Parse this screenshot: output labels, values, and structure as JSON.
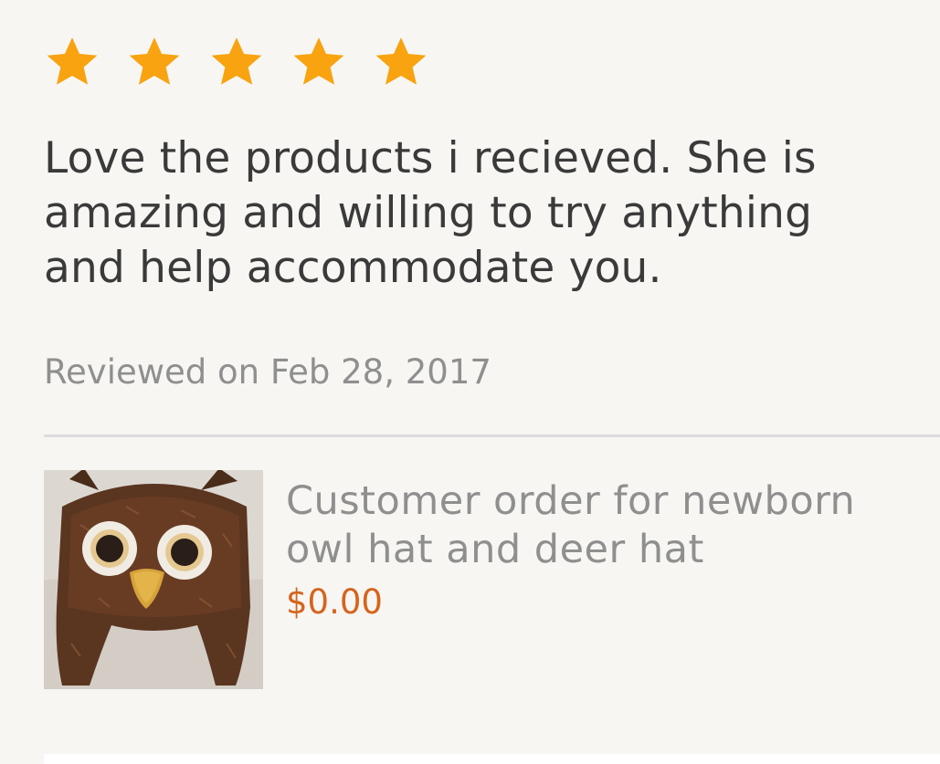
{
  "rating": {
    "stars": 5,
    "max": 5,
    "star_color": "#f8a30f"
  },
  "review": {
    "text": "Love the products i recieved. She is amazing and willing to try anything and help accommodate you.",
    "date": "Reviewed on Feb 28, 2017"
  },
  "item": {
    "image_icon": "owl-hat-photo",
    "title": "Customer order for newborn owl hat and deer hat",
    "price": "$0.00",
    "price_color": "#d5641c"
  }
}
